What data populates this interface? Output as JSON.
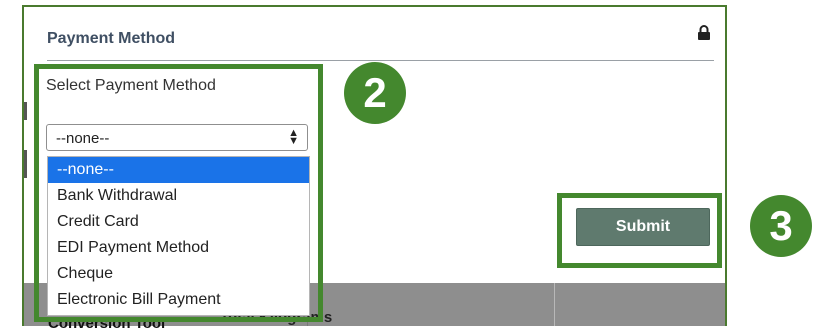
{
  "panel": {
    "title": "Payment Method",
    "lock_icon": "lock-icon"
  },
  "select": {
    "label": "Select Payment Method",
    "value": "--none--",
    "options": [
      "--none--",
      "Bank Withdrawal",
      "Credit Card",
      "EDI Payment Method",
      "Cheque",
      "Electronic Bill Payment"
    ],
    "selected_index": 0
  },
  "submit": {
    "label": "Submit"
  },
  "background": {
    "conversion_tool": "Conversion Tool",
    "total_kilograms": "Total Kilograms"
  },
  "callouts": {
    "step2": "2",
    "step3": "3"
  },
  "colors": {
    "highlight_green": "#44882e",
    "submit_bg": "#5f7a6e",
    "option_selected": "#1a73e8",
    "title_text": "#3f4f63"
  }
}
